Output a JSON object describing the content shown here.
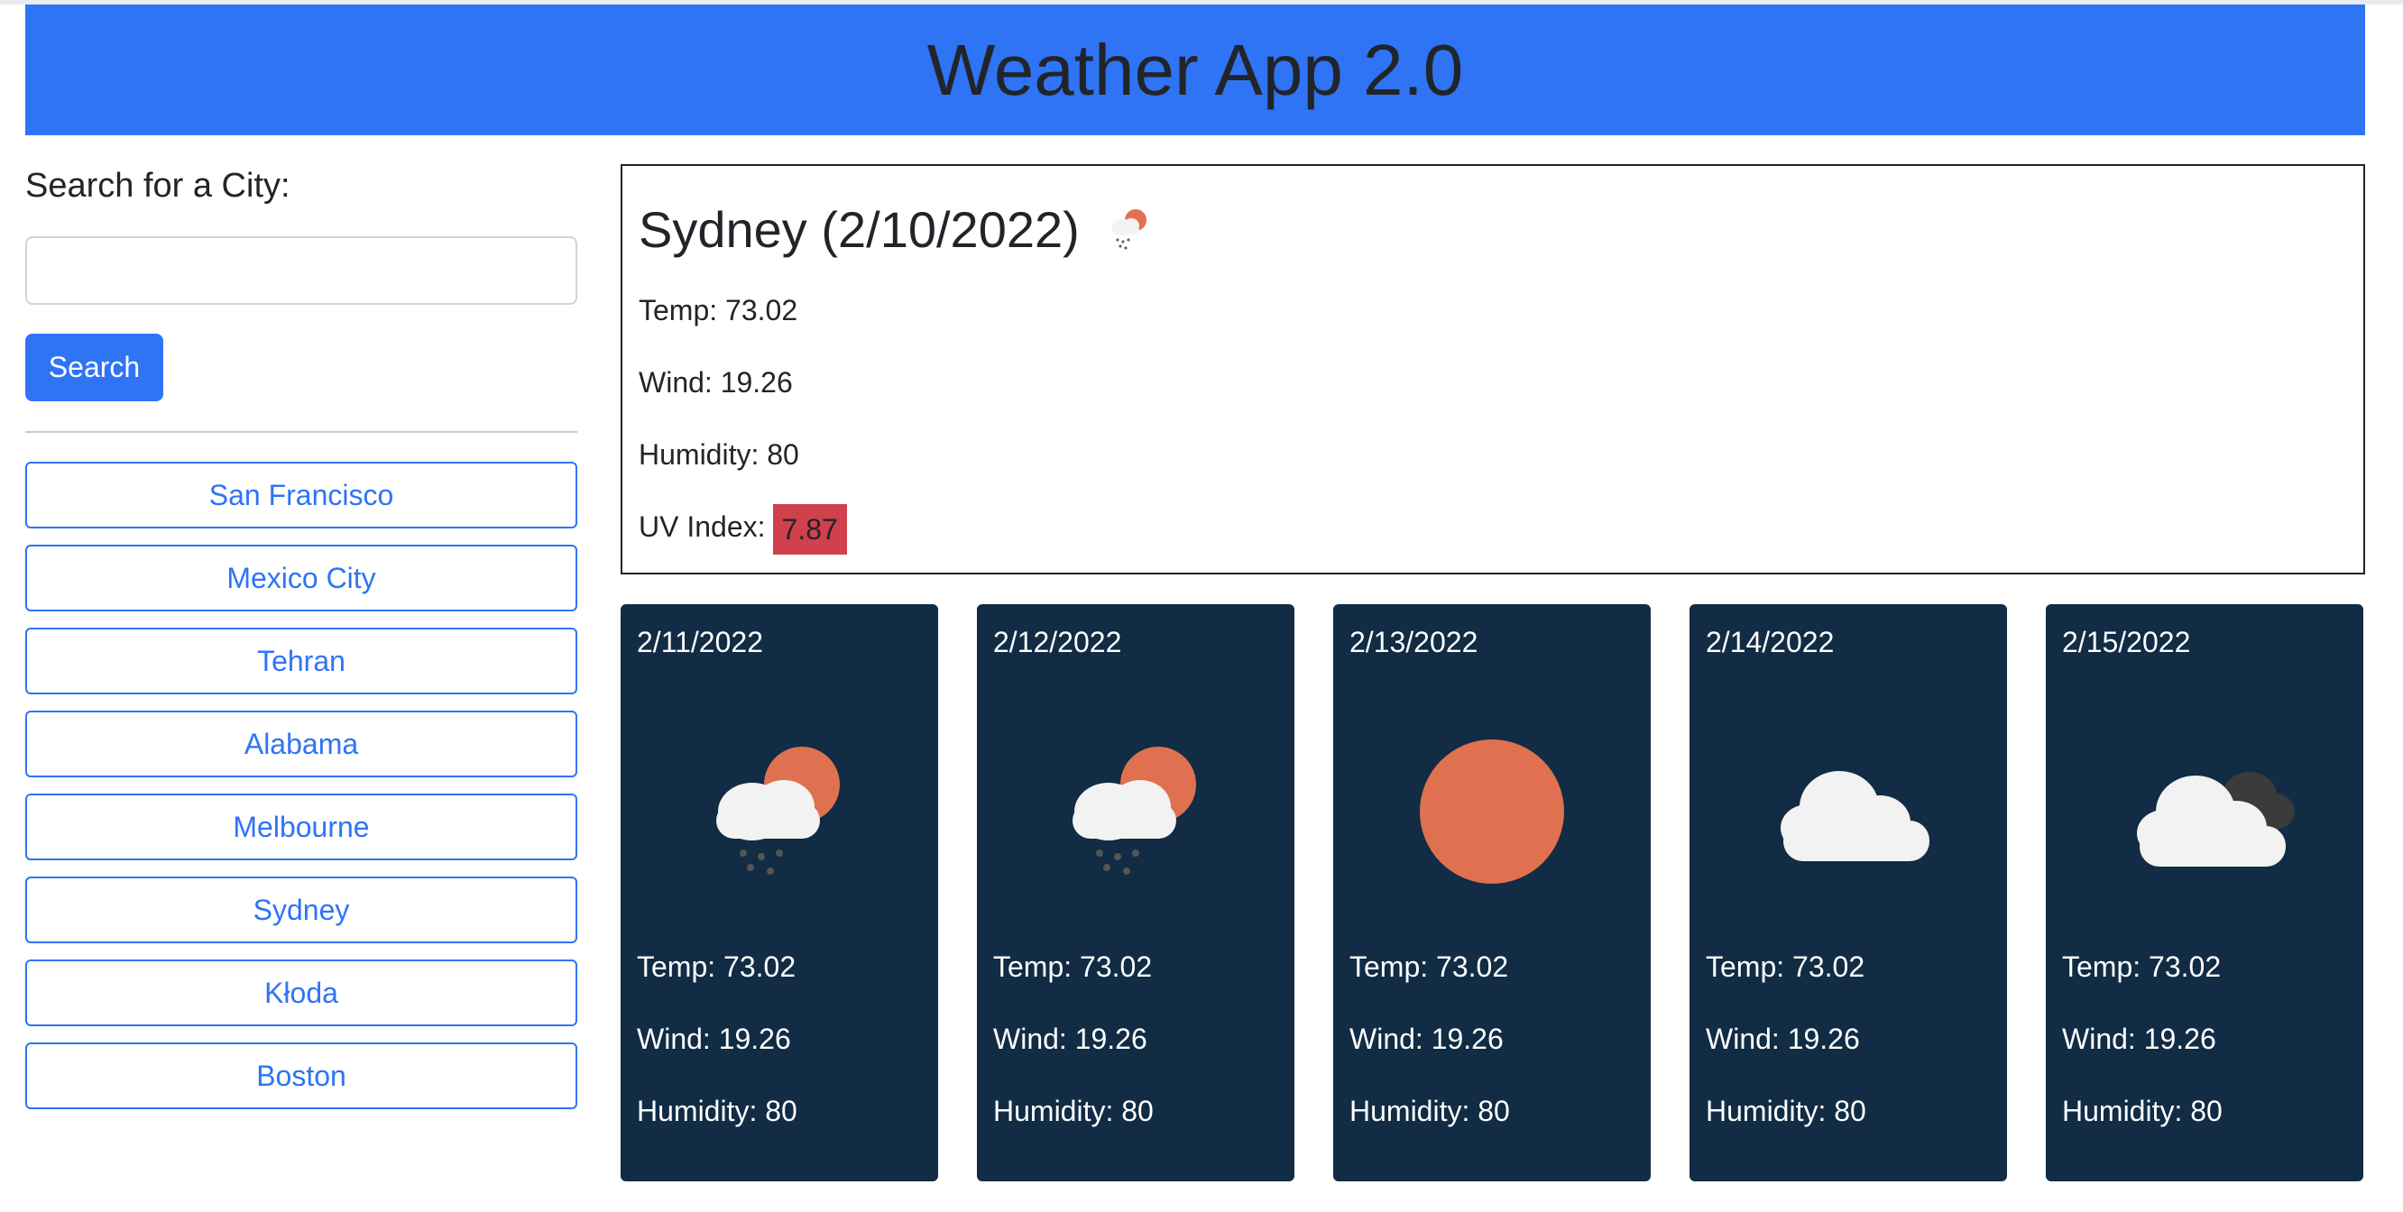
{
  "app": {
    "title": "Weather App 2.0"
  },
  "search": {
    "label": "Search for a City:",
    "value": "",
    "placeholder": "",
    "button_label": "Search"
  },
  "history": [
    "San Francisco",
    "Mexico City",
    "Tehran",
    "Alabama",
    "Melbourne",
    "Sydney",
    "Kłoda",
    "Boston"
  ],
  "current": {
    "heading": "Sydney (2/10/2022)",
    "icon": "snow-sun-icon",
    "temp": "Temp: 73.02",
    "wind": "Wind: 19.26",
    "humidity": "Humidity: 80",
    "uv_label": "UV Index:",
    "uv_value": "7.87"
  },
  "forecast": [
    {
      "date": "2/11/2022",
      "icon": "snow-sun-icon",
      "temp": "Temp: 73.02",
      "wind": "Wind: 19.26",
      "humidity": "Humidity: 80"
    },
    {
      "date": "2/12/2022",
      "icon": "snow-sun-icon",
      "temp": "Temp: 73.02",
      "wind": "Wind: 19.26",
      "humidity": "Humidity: 80"
    },
    {
      "date": "2/13/2022",
      "icon": "sun-icon",
      "temp": "Temp: 73.02",
      "wind": "Wind: 19.26",
      "humidity": "Humidity: 80"
    },
    {
      "date": "2/14/2022",
      "icon": "cloud-icon",
      "temp": "Temp: 73.02",
      "wind": "Wind: 19.26",
      "humidity": "Humidity: 80"
    },
    {
      "date": "2/15/2022",
      "icon": "dark-cloud-icon",
      "temp": "Temp: 73.02",
      "wind": "Wind: 19.26",
      "humidity": "Humidity: 80"
    }
  ],
  "colors": {
    "header": "#2e74f5",
    "card": "#112c44",
    "uv_badge": "#d0414d",
    "sun": "#e07150"
  }
}
